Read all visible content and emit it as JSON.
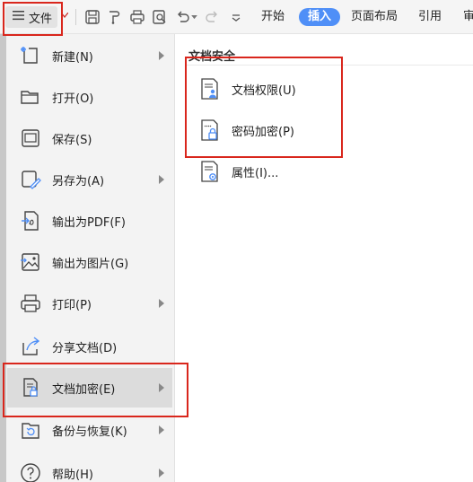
{
  "toolbar": {
    "file_label": "文件",
    "tabs": [
      "开始",
      "插入",
      "页面布局",
      "引用",
      "审"
    ],
    "active_tab_index": 1,
    "accent_color": "#4f8ff7"
  },
  "file_menu": {
    "items": [
      {
        "label": "新建(N)",
        "icon": "new-file-icon",
        "has_submenu": true
      },
      {
        "label": "打开(O)",
        "icon": "folder-open-icon",
        "has_submenu": false
      },
      {
        "label": "保存(S)",
        "icon": "save-icon",
        "has_submenu": false
      },
      {
        "label": "另存为(A)",
        "icon": "save-as-icon",
        "has_submenu": true
      },
      {
        "label": "输出为PDF(F)",
        "icon": "export-pdf-icon",
        "has_submenu": false
      },
      {
        "label": "输出为图片(G)",
        "icon": "export-image-icon",
        "has_submenu": false
      },
      {
        "label": "打印(P)",
        "icon": "printer-icon",
        "has_submenu": true
      },
      {
        "label": "分享文档(D)",
        "icon": "share-icon",
        "has_submenu": false
      },
      {
        "label": "文档加密(E)",
        "icon": "document-lock-icon",
        "has_submenu": true,
        "highlighted": true
      },
      {
        "label": "备份与恢复(K)",
        "icon": "backup-restore-icon",
        "has_submenu": true
      },
      {
        "label": "帮助(H)",
        "icon": "help-icon",
        "has_submenu": true
      }
    ]
  },
  "submenu": {
    "title": "文档安全",
    "items": [
      {
        "label": "文档权限(U)",
        "icon": "document-permission-icon"
      },
      {
        "label": "密码加密(P)",
        "icon": "password-lock-icon"
      },
      {
        "label": "属性(I)...",
        "icon": "document-properties-icon"
      }
    ]
  },
  "annotation_color": "#d9261c"
}
